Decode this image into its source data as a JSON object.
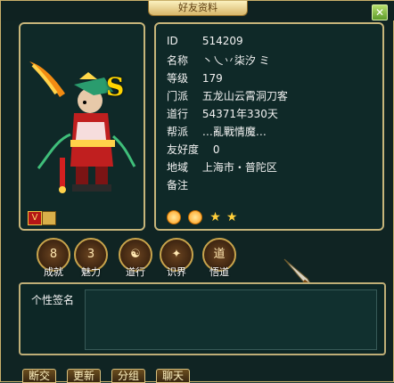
{
  "window": {
    "title": "好友资料"
  },
  "profile": {
    "id_label": "ID",
    "id_value": "514209",
    "name_label": "名称",
    "name_value": "丶乀丷柒汐 ミ",
    "level_label": "等级",
    "level_value": "179",
    "sect_label": "门派",
    "sect_value": "五龙山云霄洞刀客",
    "daoxing_label": "道行",
    "daoxing_value": "54371年330天",
    "guild_label": "帮派",
    "guild_value": "…亂戰情魔…",
    "friendship_label": "友好度",
    "friendship_value": "0",
    "region_label": "地域",
    "region_value": "上海市・普陀区",
    "notes_label": "备注",
    "notes_value": ""
  },
  "actions": [
    {
      "label": "成就",
      "icon": "achievement-icon",
      "glyph": "8"
    },
    {
      "label": "魅力",
      "icon": "charm-icon",
      "glyph": "3"
    },
    {
      "label": "道行",
      "icon": "taiji-icon",
      "glyph": "☯"
    },
    {
      "label": "识界",
      "icon": "emblem-icon",
      "glyph": "✦"
    },
    {
      "label": "悟道",
      "icon": "book-icon",
      "glyph": "道"
    }
  ],
  "signature": {
    "label": "个性签名",
    "value": ""
  },
  "bottom_buttons": [
    "断交",
    "更新",
    "分组",
    "聊天"
  ],
  "portrait": {
    "letter": "S"
  },
  "colors": {
    "border_gold": "#c7b57a",
    "panel_bg": "#0f2928",
    "text": "#f2f2f2"
  }
}
